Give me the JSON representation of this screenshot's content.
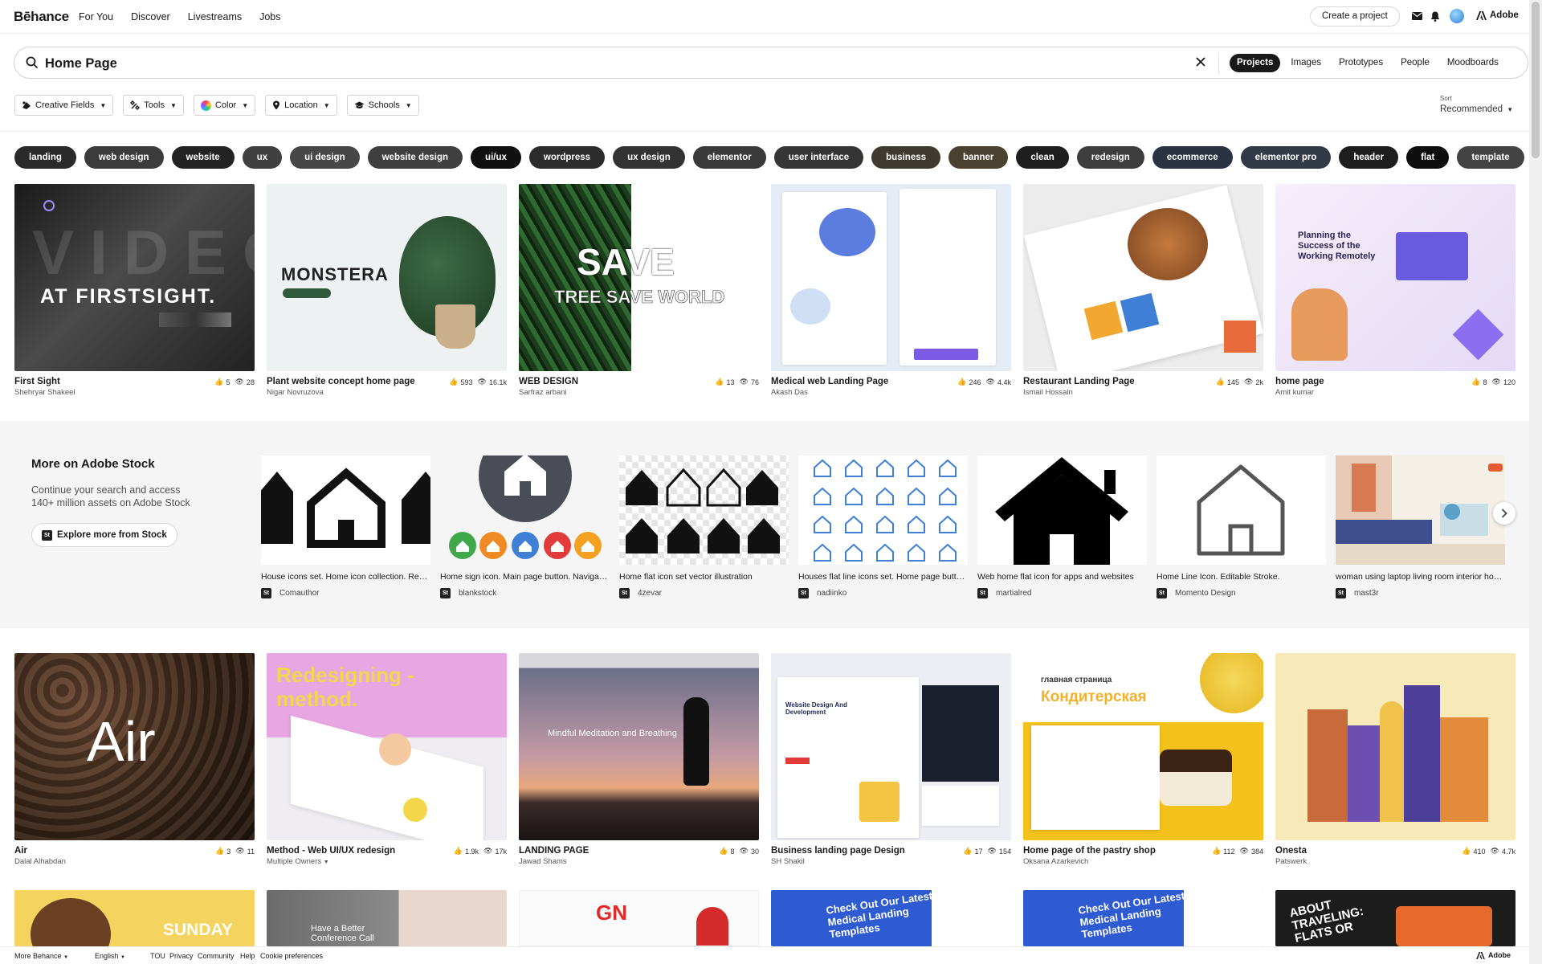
{
  "nav": {
    "logo": "Bēhance",
    "links": [
      "For You",
      "Discover",
      "Livestreams",
      "Jobs"
    ],
    "create": "Create a project",
    "adobe": "Adobe"
  },
  "search": {
    "value": "Home Page",
    "tabs": [
      "Projects",
      "Images",
      "Prototypes",
      "People",
      "Moodboards"
    ],
    "active_tab": "Projects"
  },
  "filters": [
    {
      "label": "Creative Fields",
      "icon": "creative-fields-icon"
    },
    {
      "label": "Tools",
      "icon": "tools-icon"
    },
    {
      "label": "Color",
      "icon": "color-wheel-icon"
    },
    {
      "label": "Location",
      "icon": "location-pin-icon"
    },
    {
      "label": "Schools",
      "icon": "school-icon"
    }
  ],
  "sort": {
    "label": "Sort",
    "value": "Recommended"
  },
  "chips": [
    {
      "label": "landing",
      "color": "#2a2a2a"
    },
    {
      "label": "web design",
      "color": "#3b3b3b"
    },
    {
      "label": "website",
      "color": "#232323"
    },
    {
      "label": "ux",
      "color": "#404040"
    },
    {
      "label": "ui design",
      "color": "#474747"
    },
    {
      "label": "website design",
      "color": "#3f3f3f"
    },
    {
      "label": "ui/ux",
      "color": "#101010"
    },
    {
      "label": "wordpress",
      "color": "#2c2c2c"
    },
    {
      "label": "ux design",
      "color": "#333333"
    },
    {
      "label": "elementor",
      "color": "#3a3a3a"
    },
    {
      "label": "user interface",
      "color": "#353535"
    },
    {
      "label": "business",
      "color": "#3f3a30"
    },
    {
      "label": "banner",
      "color": "#4a4130"
    },
    {
      "label": "clean",
      "color": "#1e1e1e"
    },
    {
      "label": "redesign",
      "color": "#3d3d3d"
    },
    {
      "label": "ecommerce",
      "color": "#2b3342"
    },
    {
      "label": "elementor pro",
      "color": "#323a48"
    },
    {
      "label": "header",
      "color": "#1e1e1e"
    },
    {
      "label": "flat",
      "color": "#0d0d0d"
    },
    {
      "label": "template",
      "color": "#434343"
    }
  ],
  "row1": [
    {
      "title": "First Sight",
      "owner": "Shehryar Shakeel",
      "likes": "5",
      "views": "28",
      "thumb_text": "AT FIRSTSIGHT."
    },
    {
      "title": "Plant website concept home page",
      "owner": "Nigar Novruzova",
      "likes": "593",
      "views": "16.1k",
      "thumb_text": "MONSTERA"
    },
    {
      "title": "WEB DESIGN",
      "owner": "Sarfraz arbani",
      "likes": "13",
      "views": "76",
      "thumb_text": "SAVE",
      "thumb_sub": "TREE SAVE WORLD"
    },
    {
      "title": "Medical web Landing Page",
      "owner": "Akash Das",
      "likes": "246",
      "views": "4.4k"
    },
    {
      "title": "Restaurant Landing Page",
      "owner": "Ismail Hossain",
      "likes": "145",
      "views": "2k"
    },
    {
      "title": "home page",
      "owner": "Amit kumar",
      "likes": "8",
      "views": "120",
      "thumb_text": "Planning the Success of the Working Remotely"
    }
  ],
  "stock": {
    "title": "More on Adobe Stock",
    "desc": "Continue your search and access 140+ million assets on Adobe Stock",
    "button": "Explore more from Stock",
    "items": [
      {
        "caption": "House icons set. Home icon collection. Real ...",
        "author": "Comauthor"
      },
      {
        "caption": "Home sign icon. Main page button. Navigation",
        "author": "blankstock"
      },
      {
        "caption": "Home flat icon set vector illustration",
        "author": "4zevar"
      },
      {
        "caption": "Houses flat line icons set. Home page button....",
        "author": "nadiinko"
      },
      {
        "caption": "Web home flat icon for apps and websites",
        "author": "martialred"
      },
      {
        "caption": "Home Line Icon. Editable Stroke.",
        "author": "Momento Design"
      },
      {
        "caption": "woman using laptop living room interior hom...",
        "author": "mast3r"
      }
    ]
  },
  "row2": [
    {
      "title": "Air",
      "owner": "Dalal Alhabdan",
      "likes": "3",
      "views": "11",
      "thumb_text": "Air"
    },
    {
      "title": "Method - Web UI/UX redesign",
      "owner": "Multiple Owners",
      "likes": "1.9k",
      "views": "17k",
      "thumb_text": "Redesigning - method."
    },
    {
      "title": "LANDING PAGE",
      "owner": "Jawad Shams",
      "likes": "8",
      "views": "30",
      "thumb_text": "Mindful Meditation and Breathing"
    },
    {
      "title": "Business landing page Design",
      "owner": "SH Shakil",
      "likes": "17",
      "views": "154",
      "thumb_text": "Website Design And Development"
    },
    {
      "title": "Home page of the pastry shop",
      "owner": "Oksana Azarkevich",
      "likes": "112",
      "views": "384",
      "thumb_text": "Кондитерская",
      "thumb_sub": "главная страница"
    },
    {
      "title": "Onesta",
      "owner": "Patswerk",
      "likes": "410",
      "views": "4.7k"
    }
  ],
  "row3": [
    {
      "thumb_text": "SUNDAY"
    },
    {
      "thumb_text": "Have a Better Conference Call"
    },
    {
      "thumb_text": "GN"
    },
    {
      "thumb_text": "Check Out Our Latest Medical Landing Templates"
    },
    {
      "thumb_text": "Check Out Our Latest Medical Landing Templates"
    },
    {
      "thumb_text": "ABOUT TRAVELING: FLATS OR"
    }
  ],
  "footer": {
    "more": "More Behance",
    "lang": "English",
    "links": [
      "TOU",
      "Privacy",
      "Community",
      "Help",
      "Cookie preferences"
    ],
    "adobe": "Adobe"
  }
}
